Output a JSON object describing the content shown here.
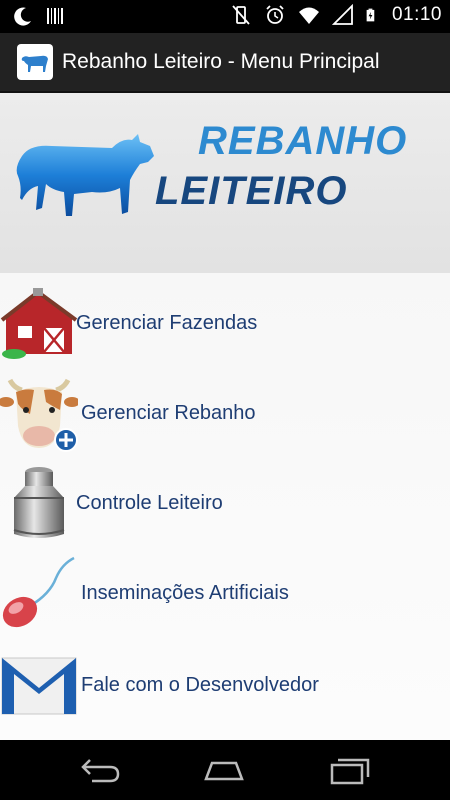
{
  "status_bar": {
    "time": "01:10",
    "left_icons": [
      "moon-icon",
      "barcode-icon"
    ],
    "right_icons": [
      "vibrate-off-icon",
      "alarm-icon",
      "wifi-icon",
      "signal-icon",
      "battery-charging-icon"
    ]
  },
  "action_bar": {
    "title": "Rebanho Leiteiro - Menu Principal",
    "icon": "cow-app-icon"
  },
  "banner": {
    "line1": "REBANHO",
    "line2": "LEITEIRO"
  },
  "menu": {
    "items": [
      {
        "label": "Gerenciar Fazendas",
        "icon": "barn-icon"
      },
      {
        "label": "Gerenciar Rebanho",
        "icon": "cow-head-add-icon"
      },
      {
        "label": "Controle Leiteiro",
        "icon": "milk-can-icon"
      },
      {
        "label": "Inseminações Artificiais",
        "icon": "sperm-icon"
      },
      {
        "label": "Fale com o Desenvolvedor",
        "icon": "mail-icon"
      }
    ]
  },
  "nav_bar": {
    "buttons": [
      "back-icon",
      "home-icon",
      "recents-icon"
    ]
  },
  "colors": {
    "label_text": "#1e3d73",
    "banner_light_blue": "#2d8ad0",
    "banner_dark_blue": "#17477f",
    "action_bar": "#222222"
  }
}
